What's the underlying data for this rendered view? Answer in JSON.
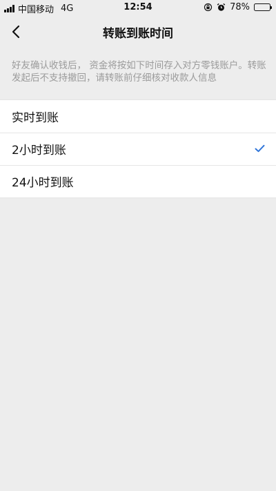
{
  "status_bar": {
    "carrier": "中国移动",
    "network": "4G",
    "time": "12:54",
    "battery_percent": "78%",
    "battery_level": 0.78
  },
  "nav": {
    "title": "转账到账时间",
    "back_icon": "chevron-left-icon"
  },
  "tip": "好友确认收钱后， 资金将按如下时间存入对方零钱账户。转账发起后不支持撤回，请转账前仔细核对收款人信息",
  "options": [
    {
      "label": "实时到账",
      "selected": false
    },
    {
      "label": "2小时到账",
      "selected": true
    },
    {
      "label": "24小时到账",
      "selected": false
    }
  ],
  "colors": {
    "background": "#ededed",
    "card": "#ffffff",
    "accent": "#2f75d9",
    "tip_text": "#9b9b9b"
  }
}
